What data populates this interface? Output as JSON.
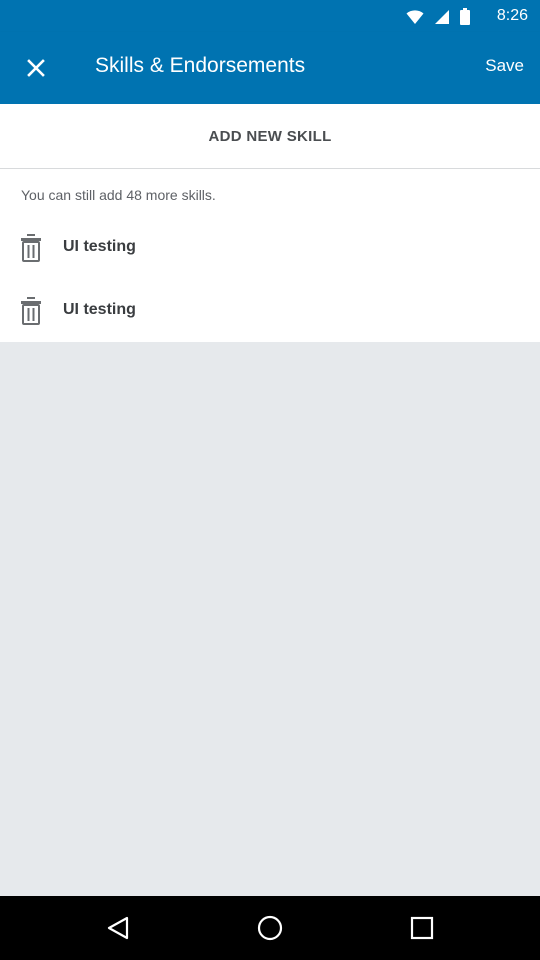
{
  "status_bar": {
    "time": "8:26",
    "icons": [
      "wifi-icon",
      "signal-icon",
      "battery-icon"
    ]
  },
  "header": {
    "title": "Skills & Endorsements",
    "close_icon": "close-icon",
    "save_label": "Save"
  },
  "add_skill": {
    "label": "ADD NEW SKILL"
  },
  "skills": {
    "hint": "You can still add 48 more skills.",
    "items": [
      {
        "label": "UI testing",
        "icon": "trash-icon"
      },
      {
        "label": "UI testing",
        "icon": "trash-icon"
      }
    ]
  },
  "nav_bar": {
    "buttons": [
      "back-icon",
      "home-icon",
      "recents-icon"
    ]
  },
  "colors": {
    "brand": "#0073b1",
    "background": "#e6e9ec",
    "surface": "#ffffff",
    "nav": "#000000"
  }
}
